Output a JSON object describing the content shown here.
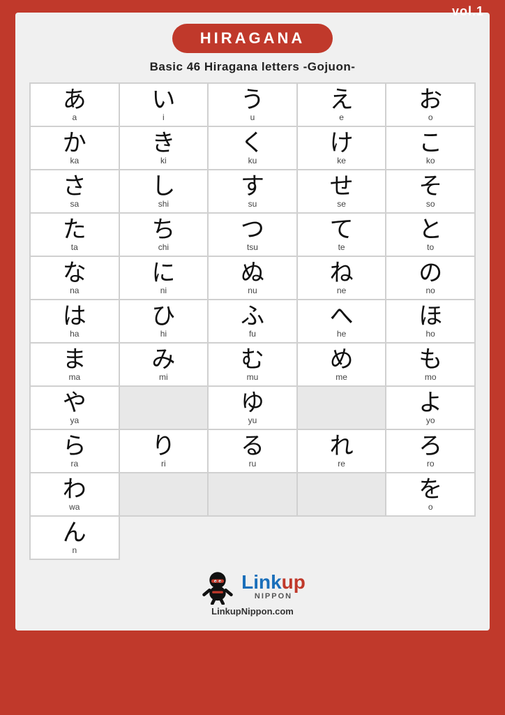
{
  "page": {
    "vol": "vol.1",
    "title": "HIRAGANA",
    "subtitle": "Basic 46 Hiragana letters -Gojuon-",
    "website": "LinkupNippon.com",
    "nippon": "NIPPON"
  },
  "rows": [
    [
      {
        "kana": "あ",
        "roma": "a"
      },
      {
        "kana": "い",
        "roma": "i"
      },
      {
        "kana": "う",
        "roma": "u"
      },
      {
        "kana": "え",
        "roma": "e"
      },
      {
        "kana": "お",
        "roma": "o"
      }
    ],
    [
      {
        "kana": "か",
        "roma": "ka"
      },
      {
        "kana": "き",
        "roma": "ki"
      },
      {
        "kana": "く",
        "roma": "ku"
      },
      {
        "kana": "け",
        "roma": "ke"
      },
      {
        "kana": "こ",
        "roma": "ko"
      }
    ],
    [
      {
        "kana": "さ",
        "roma": "sa"
      },
      {
        "kana": "し",
        "roma": "shi"
      },
      {
        "kana": "す",
        "roma": "su"
      },
      {
        "kana": "せ",
        "roma": "se"
      },
      {
        "kana": "そ",
        "roma": "so"
      }
    ],
    [
      {
        "kana": "た",
        "roma": "ta"
      },
      {
        "kana": "ち",
        "roma": "chi"
      },
      {
        "kana": "つ",
        "roma": "tsu"
      },
      {
        "kana": "て",
        "roma": "te"
      },
      {
        "kana": "と",
        "roma": "to"
      }
    ],
    [
      {
        "kana": "な",
        "roma": "na"
      },
      {
        "kana": "に",
        "roma": "ni"
      },
      {
        "kana": "ぬ",
        "roma": "nu"
      },
      {
        "kana": "ね",
        "roma": "ne"
      },
      {
        "kana": "の",
        "roma": "no"
      }
    ],
    [
      {
        "kana": "は",
        "roma": "ha"
      },
      {
        "kana": "ひ",
        "roma": "hi"
      },
      {
        "kana": "ふ",
        "roma": "fu"
      },
      {
        "kana": "へ",
        "roma": "he"
      },
      {
        "kana": "ほ",
        "roma": "ho"
      }
    ],
    [
      {
        "kana": "ま",
        "roma": "ma"
      },
      {
        "kana": "み",
        "roma": "mi"
      },
      {
        "kana": "む",
        "roma": "mu"
      },
      {
        "kana": "め",
        "roma": "me"
      },
      {
        "kana": "も",
        "roma": "mo"
      }
    ],
    [
      {
        "kana": "や",
        "roma": "ya"
      },
      null,
      {
        "kana": "ゆ",
        "roma": "yu"
      },
      null,
      {
        "kana": "よ",
        "roma": "yo"
      }
    ],
    [
      {
        "kana": "ら",
        "roma": "ra"
      },
      {
        "kana": "り",
        "roma": "ri"
      },
      {
        "kana": "る",
        "roma": "ru"
      },
      {
        "kana": "れ",
        "roma": "re"
      },
      {
        "kana": "ろ",
        "roma": "ro"
      }
    ],
    [
      {
        "kana": "わ",
        "roma": "wa"
      },
      null,
      null,
      null,
      {
        "kana": "を",
        "roma": "o"
      }
    ],
    [
      {
        "kana": "ん",
        "roma": "n"
      },
      "logo",
      null,
      null,
      null
    ]
  ]
}
